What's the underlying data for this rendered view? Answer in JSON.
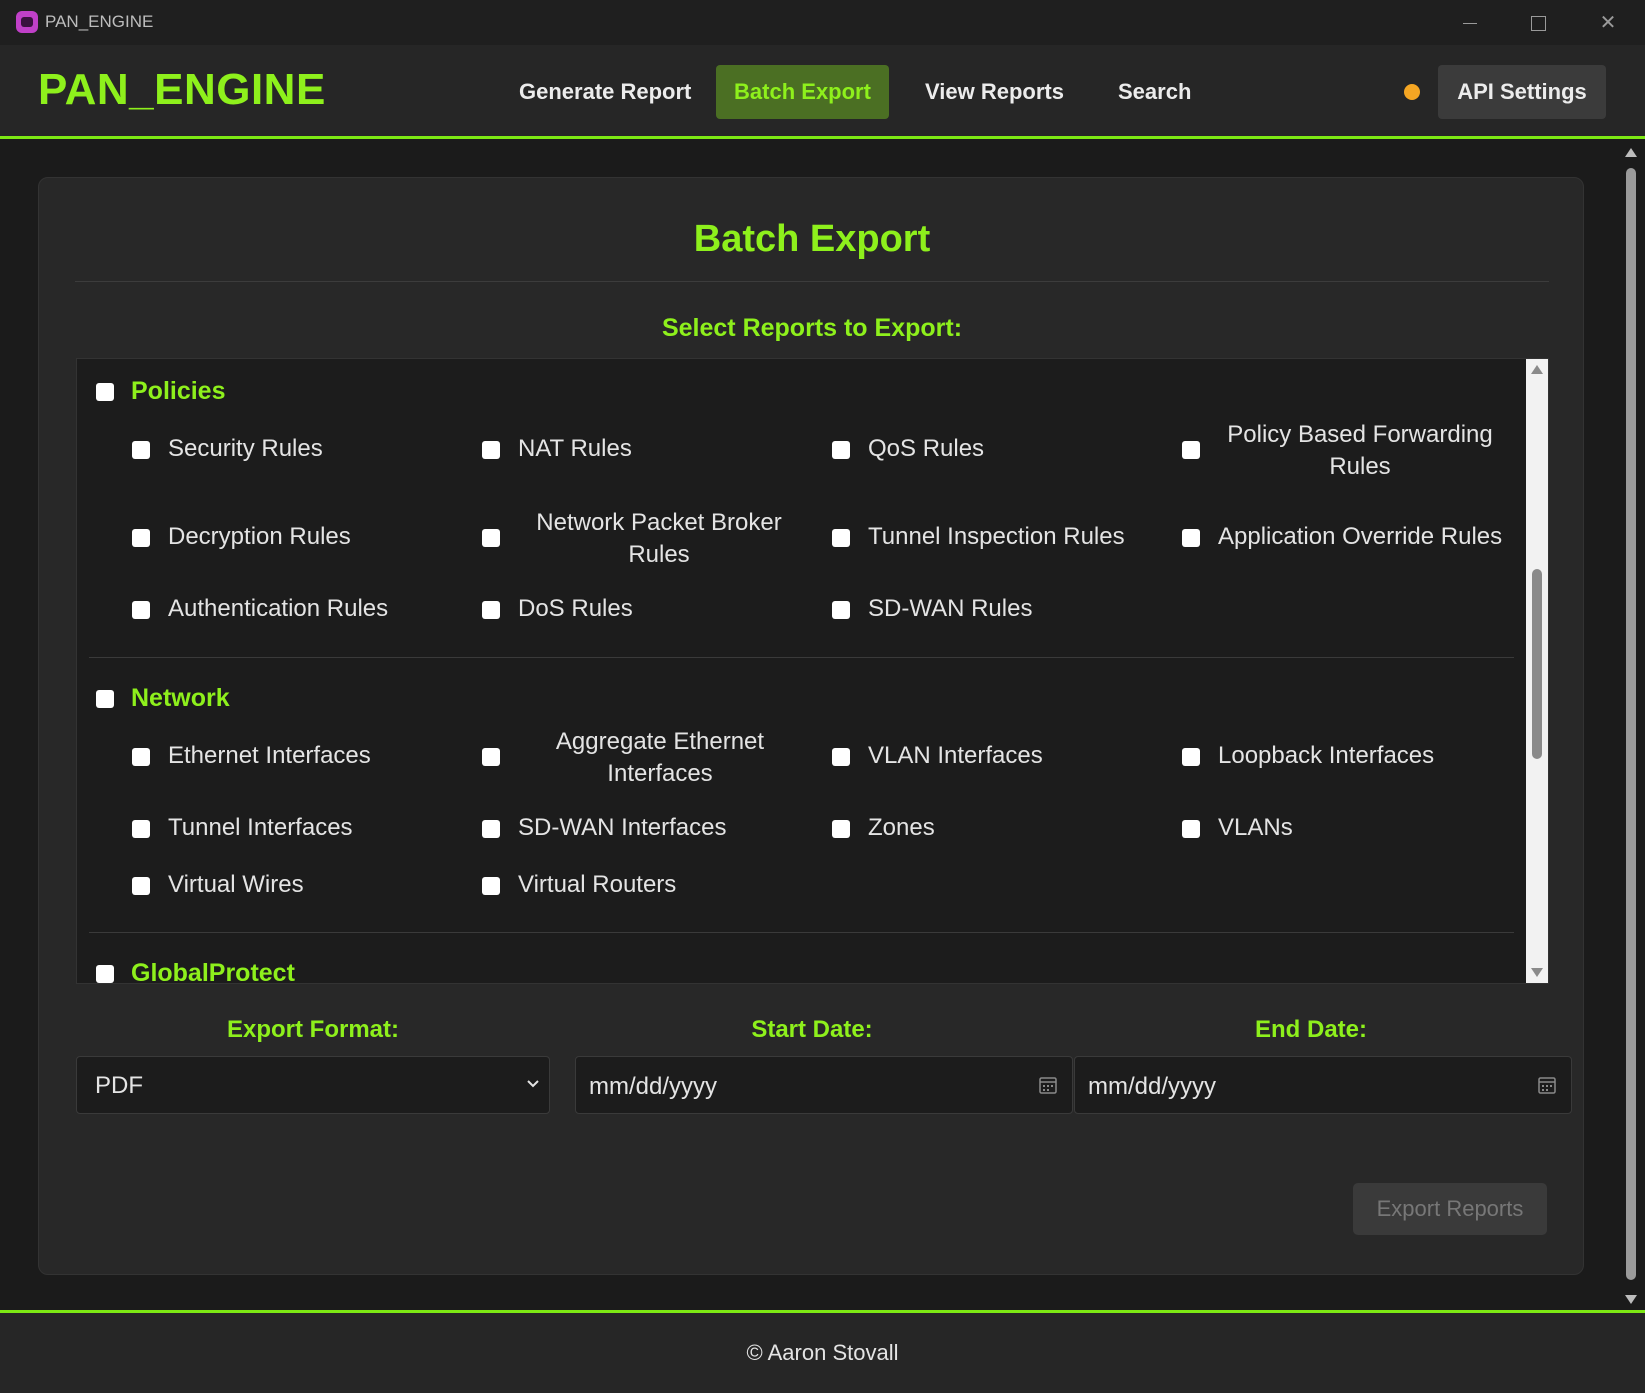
{
  "window": {
    "title": "PAN_ENGINE",
    "icon": "app-icon"
  },
  "header": {
    "logo": "PAN_ENGINE",
    "nav": {
      "generate": "Generate Report",
      "batch": "Batch Export",
      "view": "View Reports",
      "search": "Search",
      "api": "API Settings"
    },
    "active_tab": "Batch Export",
    "status_color": "#f5a623"
  },
  "card": {
    "title": "Batch Export",
    "select_label": "Select Reports to Export:"
  },
  "categories": [
    {
      "name": "Policies",
      "items": [
        "Security Rules",
        "NAT Rules",
        "QoS Rules",
        "Policy Based Forwarding Rules",
        "Decryption Rules",
        "Network Packet Broker Rules",
        "Tunnel Inspection Rules",
        "Application Override Rules",
        "Authentication Rules",
        "DoS Rules",
        "SD-WAN Rules"
      ]
    },
    {
      "name": "Network",
      "items": [
        "Ethernet Interfaces",
        "Aggregate Ethernet Interfaces",
        "VLAN Interfaces",
        "Loopback Interfaces",
        "Tunnel Interfaces",
        "SD-WAN Interfaces",
        "Zones",
        "VLANs",
        "Virtual Wires",
        "Virtual Routers"
      ]
    },
    {
      "name": "GlobalProtect",
      "items": []
    }
  ],
  "form": {
    "format_label": "Export Format:",
    "format_value": "PDF",
    "start_label": "Start Date:",
    "start_placeholder": "mm/dd/yyyy",
    "end_label": "End Date:",
    "end_placeholder": "mm/dd/yyyy"
  },
  "export_button": "Export Reports",
  "footer": "© Aaron Stovall",
  "colors": {
    "accent": "#8ef01c",
    "active_nav_bg": "#4b6f23",
    "background": "#1b1b1b"
  }
}
